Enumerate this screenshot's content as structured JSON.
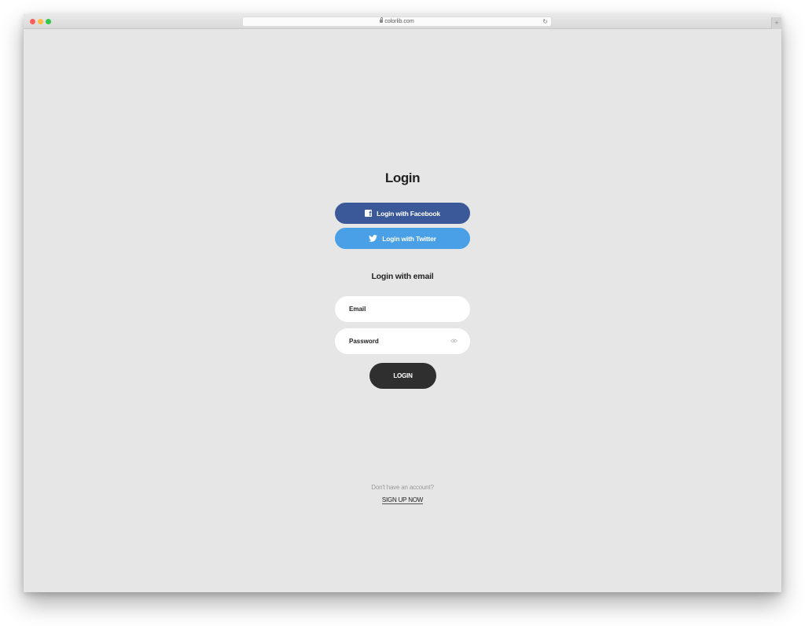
{
  "browser": {
    "url": "colorlib.com",
    "icons": {
      "lock": "lock-icon",
      "reload": "reload-icon",
      "new_tab": "plus"
    },
    "reload_glyph": "↻",
    "new_tab_glyph": "+"
  },
  "login": {
    "title": "Login",
    "facebook_label": "Login with Facebook",
    "twitter_label": "Login with Twitter",
    "email_section_title": "Login with email",
    "email_placeholder": "Email",
    "password_placeholder": "Password",
    "submit_label": "LOGIN",
    "no_account_text": "Don't have an account?",
    "signup_label": "SIGN UP NOW"
  },
  "colors": {
    "facebook": "#3b5998",
    "twitter": "#4aa0e6",
    "submit": "#2f2f2f",
    "page_background": "#e6e6e7"
  }
}
